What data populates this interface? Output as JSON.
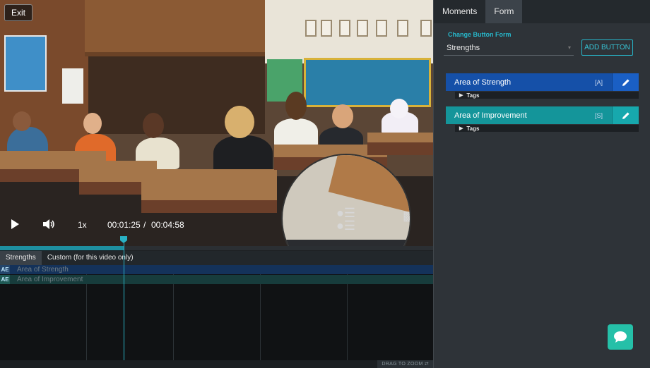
{
  "player": {
    "exit_label": "Exit",
    "speed": "1x",
    "current_time": "00:01:25",
    "time_separator": "/",
    "duration": "00:04:58",
    "progress_fraction": 0.285
  },
  "timeline": {
    "tabs": [
      {
        "label": "Strengths",
        "active": true
      },
      {
        "label": "Custom (for this video only)",
        "active": false
      }
    ],
    "rows": [
      {
        "badge": "AE",
        "label": "Area of Strength"
      },
      {
        "badge": "AE",
        "label": "Area of Improvement"
      }
    ],
    "drag_to_zoom": "DRAG TO ZOOM"
  },
  "panel": {
    "tabs": [
      {
        "label": "Moments",
        "active": false
      },
      {
        "label": "Form",
        "active": true
      }
    ],
    "change_form_title": "Change Button Form",
    "form_select": "Strengths",
    "add_button_label": "ADD BUTTON",
    "buttons": [
      {
        "label": "Area of Strength",
        "key": "[A]",
        "tags_label": "Tags",
        "color": "#1550a8"
      },
      {
        "label": "Area of Improvement",
        "key": "[S]",
        "tags_label": "Tags",
        "color": "#14959a"
      }
    ]
  },
  "colors": {
    "accent": "#27b6c9",
    "chat": "#25c0a8"
  },
  "icons": {
    "play": "play-icon",
    "volume": "volume-icon",
    "edit": "pencil-icon",
    "chat": "chat-bubble-icon"
  }
}
